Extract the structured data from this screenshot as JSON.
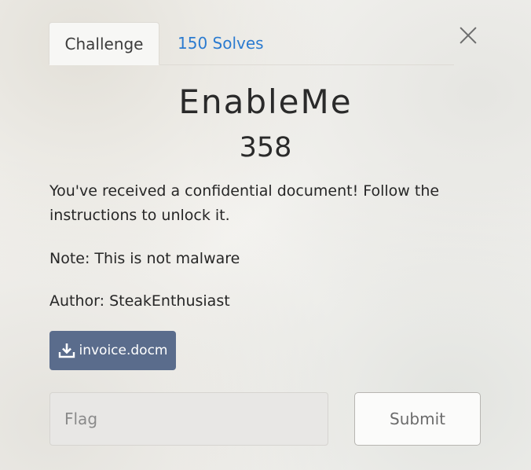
{
  "tabs": {
    "challenge_label": "Challenge",
    "solves_label": "150 Solves"
  },
  "challenge": {
    "name": "EnableMe",
    "points": "358",
    "description": "You've received a confidential document! Follow the instructions to unlock it.",
    "note": "Note: This is not malware",
    "author": "Author: SteakEnthusiast"
  },
  "file": {
    "icon": "download-icon",
    "name": "invoice.docm"
  },
  "form": {
    "flag_placeholder": "Flag",
    "flag_value": "",
    "submit_label": "Submit"
  },
  "colors": {
    "link": "#2b7bd0",
    "file_button": "#5a6c8c"
  }
}
